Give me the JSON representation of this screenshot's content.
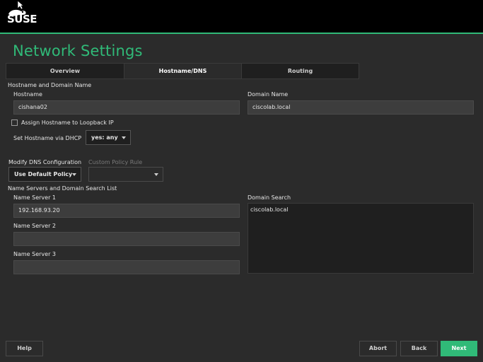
{
  "brand": {
    "logo_text": "SUSE",
    "accent": "#30ba78"
  },
  "title": "Network Settings",
  "tabs": [
    {
      "label": "Overview",
      "active": false
    },
    {
      "label": "Hostname/DNS",
      "active": true
    },
    {
      "label": "Routing",
      "active": false
    }
  ],
  "hostname_section": {
    "heading": "Hostname and Domain Name",
    "hostname_label": "Hostname",
    "hostname_value": "cishana02",
    "domain_label": "Domain Name",
    "domain_value": "ciscolab.local",
    "loopback_label": "Assign Hostname to Loopback IP",
    "loopback_checked": false,
    "dhcp_label": "Set Hostname via DHCP",
    "dhcp_value": "yes: any"
  },
  "dns_config": {
    "modify_label": "Modify DNS Configuration",
    "modify_value": "Use Default Policy",
    "custom_label": "Custom Policy Rule",
    "custom_value": ""
  },
  "nameservers": {
    "heading": "Name Servers and Domain Search List",
    "ns1_label": "Name Server 1",
    "ns1_value": "192.168.93.20",
    "ns2_label": "Name Server 2",
    "ns2_value": "",
    "ns3_label": "Name Server 3",
    "ns3_value": "",
    "search_label": "Domain Search",
    "search_value": "ciscolab.local"
  },
  "buttons": {
    "help": "Help",
    "abort": "Abort",
    "back": "Back",
    "next": "Next"
  }
}
